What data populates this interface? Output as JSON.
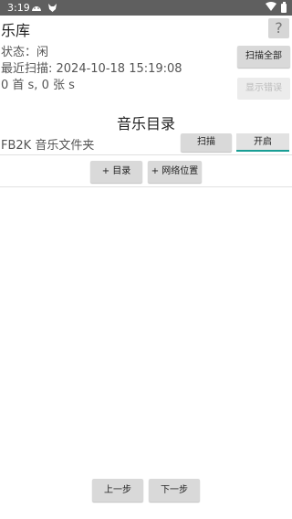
{
  "statusbar": {
    "time": "3:19",
    "icons": [
      "android-icon",
      "fox-icon"
    ],
    "right_icons": [
      "wifi-icon",
      "battery-icon"
    ]
  },
  "header": {
    "title": "乐库",
    "help_label": "?"
  },
  "library": {
    "status": "状态：闲",
    "last_scan": "最近扫描:   2024-10-18 15:19:08",
    "counts": "0 首  s, 0 张  s",
    "scan_all_label": "扫描全部",
    "show_errors_label": "显示错误"
  },
  "music_dirs": {
    "section_title": "音乐目录",
    "folder_name": "FB2K 音乐文件夹",
    "scan_label": "扫描",
    "toggle_label": "开启",
    "add_dir_label": "+ 目录",
    "add_network_label": "+ 网络位置"
  },
  "footer": {
    "prev_label": "上一步",
    "next_label": "下一步"
  },
  "colors": {
    "statusbar": "#5f5f5f",
    "button": "#d9d9d9",
    "accent": "#1a9e95"
  }
}
